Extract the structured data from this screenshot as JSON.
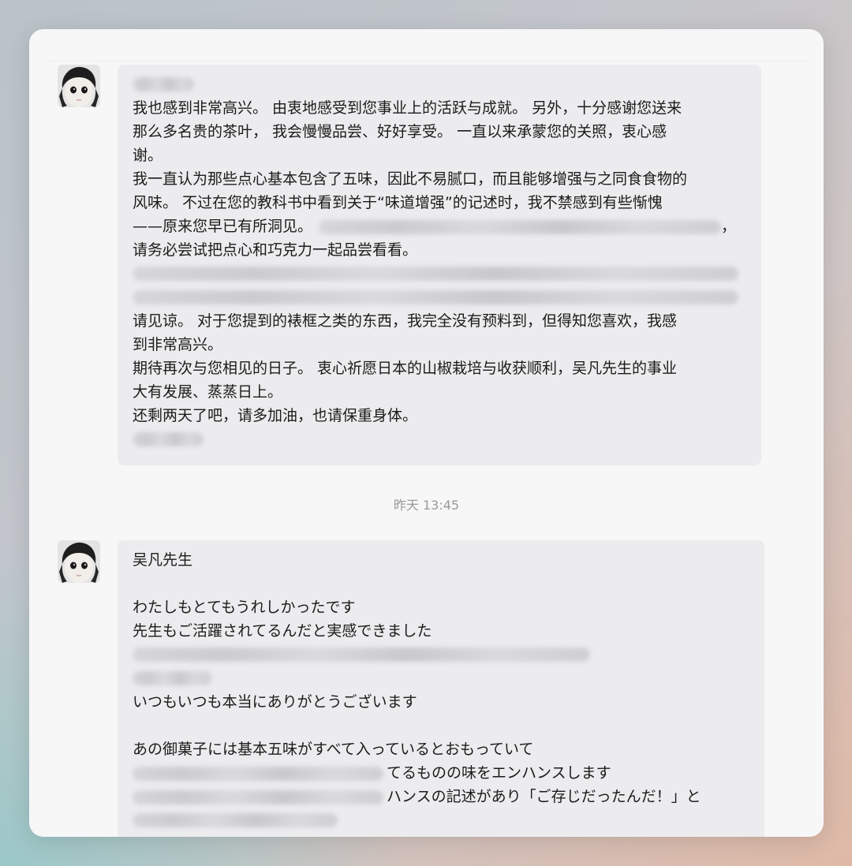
{
  "messages": [
    {
      "sender": "",
      "lines": [
        "我也感到非常高兴。 由衷地感受到您事业上的活跃与成就。 另外，十分感谢您送来",
        "那么多名贵的茶叶， 我会慢慢品尝、好好享受。 一直以来承蒙您的关照，衷心感",
        "谢。",
        "我一直认为那些点心基本包含了五味，因此不易腻口，而且能够增强与之同食食物的",
        "风味。 不过在您的教科书中看到关于“味道增强”的记述时，我不禁感到有些惭愧",
        "——原来您早已有所洞见。",
        "，",
        "请务必尝试把点心和巧克力一起品尝看看。",
        "请见谅。 对于您提到的裱框之类的东西，我完全没有预料到，但得知您喜欢，我感",
        "到非常高兴。",
        "期待再次与您相见的日子。 衷心祈愿日本的山椒栽培与收获顺利，吴凡先生的事业",
        "大有发展、蒸蒸日上。",
        "还剩两天了吧，请多加油，也请保重身体。"
      ]
    },
    {
      "sender": "吴凡先生",
      "lines": [
        "わたしもとてもうれしかったです",
        "先生もご活躍されてるんだと実感できました",
        "いつもいつも本当にありがとうございます",
        "あの御菓子には基本五味がすべて入っているとおもっていて",
        "てるものの味をエンハンスします",
        "ハンスの記述があり「ご存じだったんだ！」と"
      ]
    }
  ],
  "timestamp": "昨天 13:45"
}
